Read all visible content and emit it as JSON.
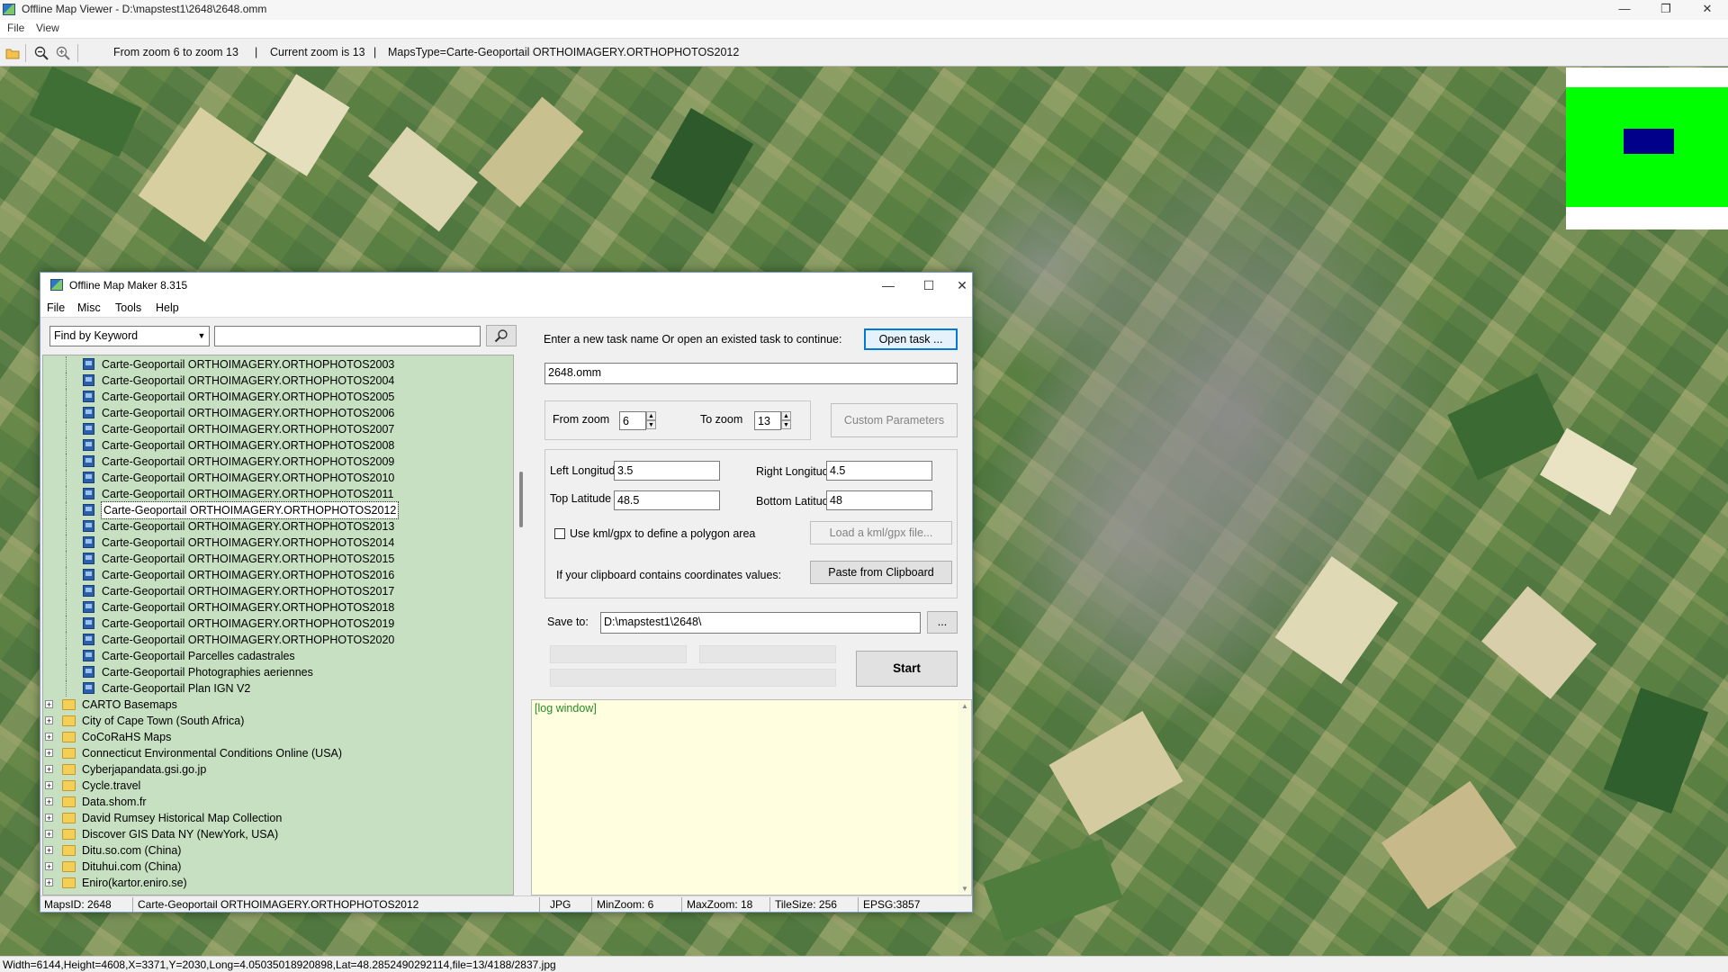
{
  "outer_window": {
    "title": "Offline Map Viewer - D:\\mapstest1\\2648\\2648.omm",
    "menu": [
      "File",
      "View"
    ],
    "toolbar_text": {
      "zoom_range": "From zoom 6 to zoom 13",
      "separator1": "|",
      "current_zoom": "Current zoom is 13",
      "separator2": "|",
      "maps_type": "MapsType=Carte-Geoportail ORTHOIMAGERY.ORTHOPHOTOS2012"
    },
    "status_bar": "Width=6144,Height=4608,X=3371,Y=2030,Long=4.05035018920898,Lat=48.2852490292114,file=13/4188/2837.jpg",
    "window_buttons": {
      "minimize": "—",
      "restore": "❐",
      "close": "✕"
    }
  },
  "dialog": {
    "title": "Offline Map Maker 8.315",
    "menu": [
      "File",
      "Misc",
      "Tools",
      "Help"
    ],
    "window_buttons": {
      "minimize": "—",
      "maximize": "☐",
      "close": "✕"
    },
    "search": {
      "mode": "Find by Keyword",
      "query": "",
      "button_icon": "search-icon"
    },
    "tree_leaves": [
      "Carte-Geoportail ORTHOIMAGERY.ORTHOPHOTOS2003",
      "Carte-Geoportail ORTHOIMAGERY.ORTHOPHOTOS2004",
      "Carte-Geoportail ORTHOIMAGERY.ORTHOPHOTOS2005",
      "Carte-Geoportail ORTHOIMAGERY.ORTHOPHOTOS2006",
      "Carte-Geoportail ORTHOIMAGERY.ORTHOPHOTOS2007",
      "Carte-Geoportail ORTHOIMAGERY.ORTHOPHOTOS2008",
      "Carte-Geoportail ORTHOIMAGERY.ORTHOPHOTOS2009",
      "Carte-Geoportail ORTHOIMAGERY.ORTHOPHOTOS2010",
      "Carte-Geoportail ORTHOIMAGERY.ORTHOPHOTOS2011",
      "Carte-Geoportail ORTHOIMAGERY.ORTHOPHOTOS2012",
      "Carte-Geoportail ORTHOIMAGERY.ORTHOPHOTOS2013",
      "Carte-Geoportail ORTHOIMAGERY.ORTHOPHOTOS2014",
      "Carte-Geoportail ORTHOIMAGERY.ORTHOPHOTOS2015",
      "Carte-Geoportail ORTHOIMAGERY.ORTHOPHOTOS2016",
      "Carte-Geoportail ORTHOIMAGERY.ORTHOPHOTOS2017",
      "Carte-Geoportail ORTHOIMAGERY.ORTHOPHOTOS2018",
      "Carte-Geoportail ORTHOIMAGERY.ORTHOPHOTOS2019",
      "Carte-Geoportail ORTHOIMAGERY.ORTHOPHOTOS2020",
      "Carte-Geoportail Parcelles cadastrales",
      "Carte-Geoportail Photographies aeriennes",
      "Carte-Geoportail Plan IGN V2"
    ],
    "selected_leaf": "Carte-Geoportail ORTHOIMAGERY.ORTHOPHOTOS2012",
    "tree_folders": [
      "CARTO Basemaps",
      "City of Cape Town (South Africa)",
      "CoCoRaHS Maps",
      "Connecticut Environmental Conditions Online (USA)",
      "Cyberjapandata.gsi.go.jp",
      "Cycle.travel",
      "Data.shom.fr",
      "David Rumsey Historical Map Collection",
      "Discover GIS Data NY (NewYork, USA)",
      "Ditu.so.com (China)",
      "Dituhui.com (China)",
      "Eniro(kartor.eniro.se)"
    ],
    "task": {
      "prompt": "Enter a new task name Or open an existed task to continue:",
      "open_button": "Open task ...",
      "name": "2648.omm"
    },
    "zoom": {
      "from_label": "From zoom",
      "from_value": "6",
      "to_label": "To zoom",
      "to_value": "13",
      "custom_button": "Custom Parameters"
    },
    "coords": {
      "left_lon_label": "Left Longitude",
      "left_lon": "3.5",
      "right_lon_label": "Right Longitude",
      "right_lon": "4.5",
      "top_lat_label": "Top Latitude",
      "top_lat": "48.5",
      "bottom_lat_label": "Bottom Latitude",
      "bottom_lat": "48",
      "kml_checkbox_label": "Use kml/gpx to define a polygon area",
      "kml_checked": false,
      "kml_button": "Load a kml/gpx file...",
      "clipboard_label": "If your clipboard contains coordinates values:",
      "clipboard_button": "Paste from Clipboard"
    },
    "save": {
      "label": "Save to:",
      "path": "D:\\mapstest1\\2648\\",
      "browse_button": "..."
    },
    "start_button": "Start",
    "log_text": "[log window]",
    "status": {
      "maps_id": "MapsID: 2648",
      "map_name": "Carte-Geoportail ORTHOIMAGERY.ORTHOPHOTOS2012",
      "format": "JPG",
      "min_zoom": "MinZoom: 6",
      "max_zoom": "MaxZoom: 18",
      "tile_size": "TileSize: 256",
      "epsg": "EPSG:3857"
    }
  },
  "colors": {
    "tree_bg": "#c6e0c1",
    "log_bg": "#ffffe0",
    "minimap_green": "#00ff00",
    "minimap_view": "#00008b"
  }
}
